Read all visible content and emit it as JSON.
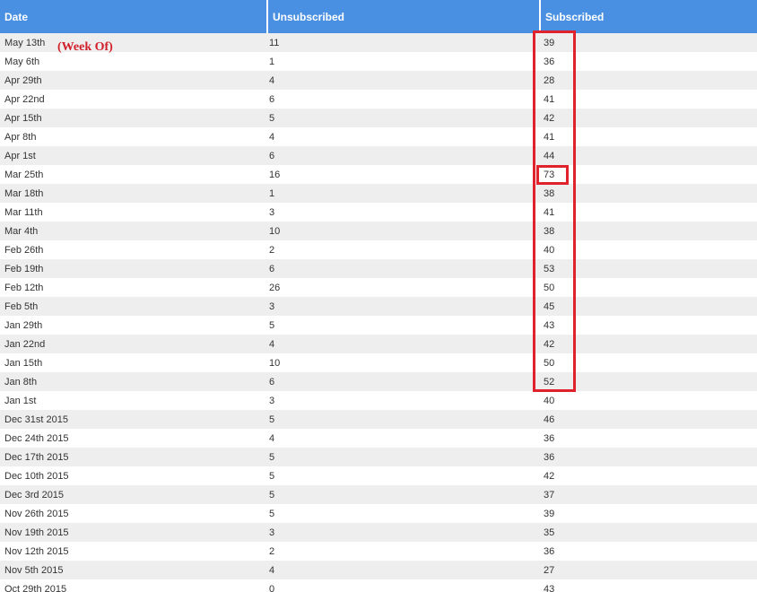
{
  "table": {
    "headers": {
      "date": "Date",
      "unsubscribed": "Unsubscribed",
      "subscribed": "Subscribed"
    },
    "rows": [
      {
        "date": "May 13th",
        "unsubscribed": "11",
        "subscribed": "39"
      },
      {
        "date": "May 6th",
        "unsubscribed": "1",
        "subscribed": "36"
      },
      {
        "date": "Apr 29th",
        "unsubscribed": "4",
        "subscribed": "28"
      },
      {
        "date": "Apr 22nd",
        "unsubscribed": "6",
        "subscribed": "41"
      },
      {
        "date": "Apr 15th",
        "unsubscribed": "5",
        "subscribed": "42"
      },
      {
        "date": "Apr 8th",
        "unsubscribed": "4",
        "subscribed": "41"
      },
      {
        "date": "Apr 1st",
        "unsubscribed": "6",
        "subscribed": "44"
      },
      {
        "date": "Mar 25th",
        "unsubscribed": "16",
        "subscribed": "73"
      },
      {
        "date": "Mar 18th",
        "unsubscribed": "1",
        "subscribed": "38"
      },
      {
        "date": "Mar 11th",
        "unsubscribed": "3",
        "subscribed": "41"
      },
      {
        "date": "Mar 4th",
        "unsubscribed": "10",
        "subscribed": "38"
      },
      {
        "date": "Feb 26th",
        "unsubscribed": "2",
        "subscribed": "40"
      },
      {
        "date": "Feb 19th",
        "unsubscribed": "6",
        "subscribed": "53"
      },
      {
        "date": "Feb 12th",
        "unsubscribed": "26",
        "subscribed": "50"
      },
      {
        "date": "Feb 5th",
        "unsubscribed": "3",
        "subscribed": "45"
      },
      {
        "date": "Jan 29th",
        "unsubscribed": "5",
        "subscribed": "43"
      },
      {
        "date": "Jan 22nd",
        "unsubscribed": "4",
        "subscribed": "42"
      },
      {
        "date": "Jan 15th",
        "unsubscribed": "10",
        "subscribed": "50"
      },
      {
        "date": "Jan 8th",
        "unsubscribed": "6",
        "subscribed": "52"
      },
      {
        "date": "Jan 1st",
        "unsubscribed": "3",
        "subscribed": "40"
      },
      {
        "date": "Dec 31st 2015",
        "unsubscribed": "5",
        "subscribed": "46"
      },
      {
        "date": "Dec 24th 2015",
        "unsubscribed": "4",
        "subscribed": "36"
      },
      {
        "date": "Dec 17th 2015",
        "unsubscribed": "5",
        "subscribed": "36"
      },
      {
        "date": "Dec 10th 2015",
        "unsubscribed": "5",
        "subscribed": "42"
      },
      {
        "date": "Dec 3rd 2015",
        "unsubscribed": "5",
        "subscribed": "37"
      },
      {
        "date": "Nov 26th 2015",
        "unsubscribed": "5",
        "subscribed": "39"
      },
      {
        "date": "Nov 19th 2015",
        "unsubscribed": "3",
        "subscribed": "35"
      },
      {
        "date": "Nov 12th 2015",
        "unsubscribed": "2",
        "subscribed": "36"
      },
      {
        "date": "Nov 5th 2015",
        "unsubscribed": "4",
        "subscribed": "27"
      },
      {
        "date": "Oct 29th 2015",
        "unsubscribed": "0",
        "subscribed": "43"
      }
    ]
  },
  "annotation": {
    "text": "(Week Of)",
    "color": "#d0202a"
  },
  "colors": {
    "header_bg": "#4a90e2",
    "header_text": "#ffffff",
    "row_alt_bg": "#eeeeee",
    "highlight": "#e0222c"
  }
}
